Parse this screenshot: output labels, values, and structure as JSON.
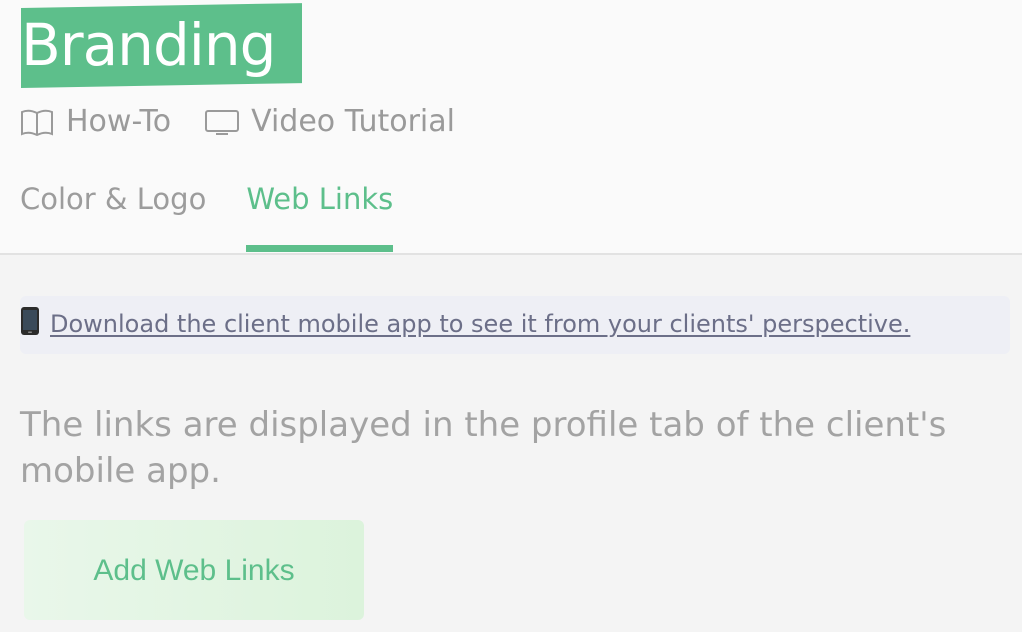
{
  "header": {
    "title": "Branding",
    "how_to_label": "How-To",
    "video_tutorial_label": "Video Tutorial"
  },
  "tabs": [
    {
      "label": "Color & Logo",
      "active": false
    },
    {
      "label": "Web Links",
      "active": true
    }
  ],
  "banner": {
    "icon": "mobile-phone-icon",
    "text": "Download the client mobile app to see it from your clients' perspective."
  },
  "main": {
    "description": "The links are displayed in the profile tab of the client's mobile app.",
    "add_button_label": "Add Web Links"
  },
  "colors": {
    "accent": "#5dbf8b",
    "muted_text": "#9a9a9a",
    "banner_bg": "#eeeff5",
    "banner_text": "#6c6f88",
    "button_bg": "#e4f5e4"
  }
}
